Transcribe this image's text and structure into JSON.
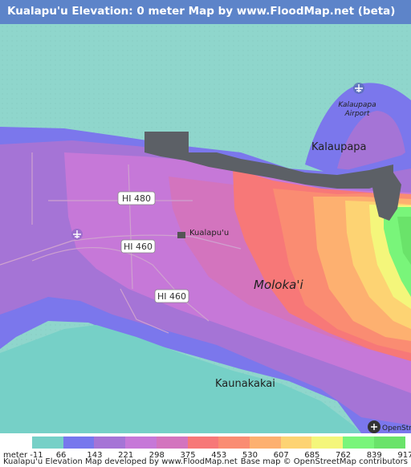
{
  "title": "Kualapu'u Elevation: 0 meter Map by www.FloodMap.net (beta)",
  "map": {
    "labels": {
      "airport_top": "Kalaupapa",
      "airport_bottom": "Airport",
      "kalaupapa": "Kalaupapa",
      "hi480": "HI 480",
      "kualapuu": "Kualapu'u",
      "hi460_west": "HI 460",
      "hi460_east": "HI 460",
      "molokai": "Moloka'i",
      "kaunakakai": "Kaunakakai"
    },
    "icons": [
      "airport-icon",
      "airport-icon",
      "town-icon",
      "openstreetmap-logo-icon"
    ],
    "osm_logo_text": "OpenStreetMap"
  },
  "legend": {
    "unit_label": "meter",
    "colors": [
      "#76d0c7",
      "#7777ed",
      "#a574d6",
      "#c678d8",
      "#d374be",
      "#f77878",
      "#fa8c72",
      "#fdb070",
      "#fdd373",
      "#f4f67b",
      "#79f57a",
      "#6ae36a"
    ],
    "values": [
      "-11",
      "66",
      "143",
      "221",
      "298",
      "375",
      "453",
      "530",
      "607",
      "685",
      "762",
      "839",
      "917"
    ]
  },
  "footer": {
    "left": "Kualapu'u Elevation Map developed by www.FloodMap.net",
    "right": "Base map © OpenStreetMap contributors"
  }
}
